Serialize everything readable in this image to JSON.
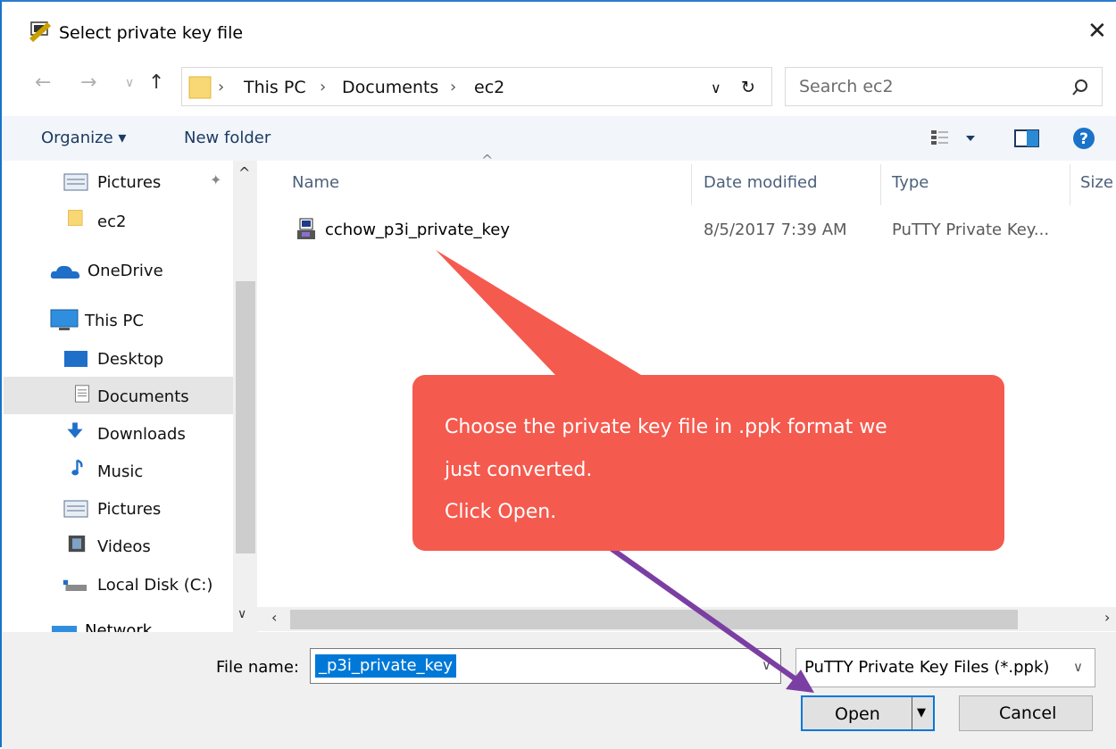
{
  "window": {
    "title": "Select private key file"
  },
  "address_bar": {
    "crumbs": [
      "This PC",
      "Documents",
      "ec2"
    ]
  },
  "search": {
    "placeholder": "Search ec2"
  },
  "toolbar": {
    "organize_label": "Organize ▾",
    "new_folder_label": "New folder"
  },
  "nav_pane": {
    "items": [
      {
        "label": "Pictures",
        "icon": "pictures-icon",
        "pinned": true
      },
      {
        "label": "ec2",
        "icon": "folder-icon"
      },
      {
        "label": "OneDrive",
        "icon": "onedrive-icon"
      },
      {
        "label": "This PC",
        "icon": "computer-icon"
      },
      {
        "label": "Desktop",
        "icon": "desktop-icon"
      },
      {
        "label": "Documents",
        "icon": "documents-icon",
        "selected": true
      },
      {
        "label": "Downloads",
        "icon": "downloads-icon"
      },
      {
        "label": "Music",
        "icon": "music-icon"
      },
      {
        "label": "Pictures",
        "icon": "pictures-icon"
      },
      {
        "label": "Videos",
        "icon": "videos-icon"
      },
      {
        "label": "Local Disk (C:)",
        "icon": "local-disk-icon"
      },
      {
        "label": "Network",
        "icon": "network-icon"
      }
    ]
  },
  "file_list": {
    "columns": [
      "Name",
      "Date modified",
      "Type",
      "Size"
    ],
    "rows": [
      {
        "name": "cchow_p3i_private_key",
        "date_modified": "8/5/2017 7:39 AM",
        "type": "PuTTY Private Key..."
      }
    ]
  },
  "bottom": {
    "file_name_label": "File name:",
    "file_name_value": "_p3i_private_key",
    "file_type_filter": "PuTTY Private Key Files (*.ppk)",
    "open_label": "Open",
    "cancel_label": "Cancel"
  },
  "annotation": {
    "lines": [
      "Choose the private key file in .ppk format we",
      "just converted.",
      "Click Open."
    ]
  },
  "colors": {
    "callout": "#f55a4e",
    "arrow": "#7b3fa3",
    "selection": "#0078d7"
  }
}
